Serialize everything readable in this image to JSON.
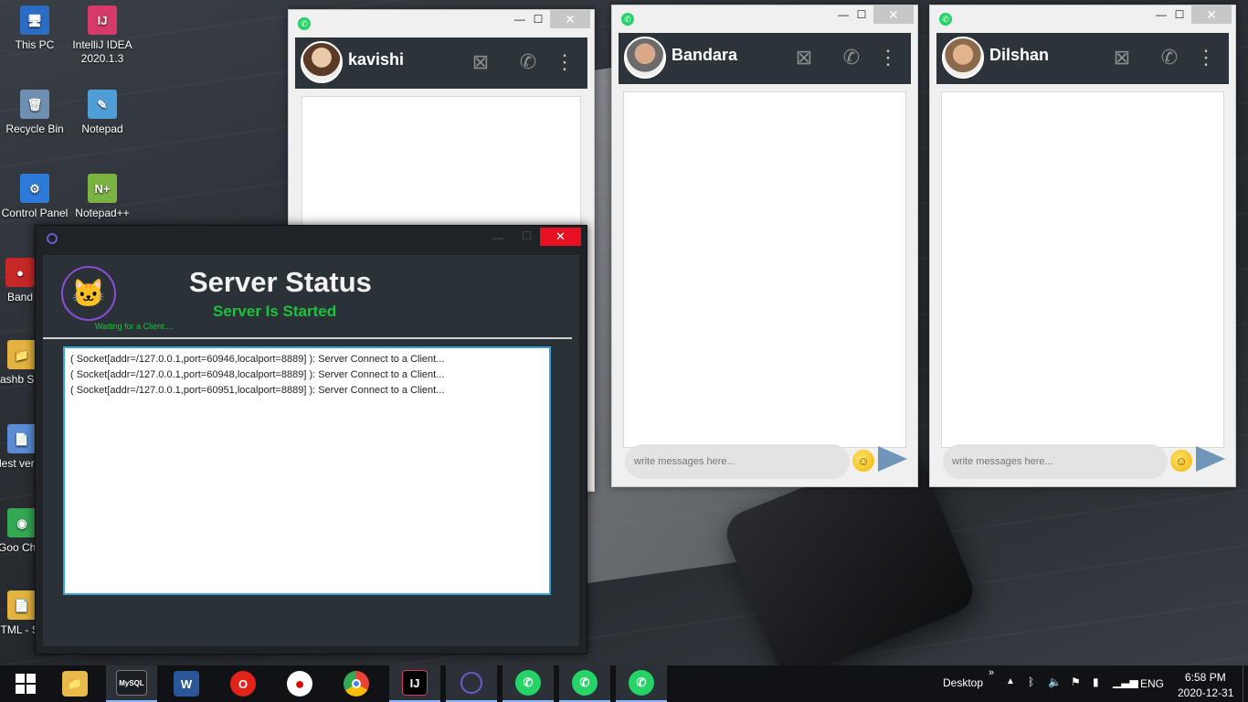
{
  "desktop": {
    "icons": [
      {
        "label": "This PC",
        "glyph": "🖥",
        "color": "#2b6cc4"
      },
      {
        "label": "IntelliJ IDEA 2020.1.3",
        "glyph": "IJ",
        "color": "#d63a6a"
      },
      {
        "label": "Recycle Bin",
        "glyph": "🗑",
        "color": "#6e8fb0"
      },
      {
        "label": "Notepad",
        "glyph": "✎",
        "color": "#4f9fd6"
      },
      {
        "label": "Control Panel",
        "glyph": "⚙",
        "color": "#2d7ad8"
      },
      {
        "label": "Notepad++",
        "glyph": "N+",
        "color": "#7bb342"
      },
      {
        "label": "Band",
        "glyph": "●",
        "color": "#c62828"
      },
      {
        "label": "dashb Shor",
        "glyph": "📁",
        "color": "#e3b341"
      },
      {
        "label": "dest versio",
        "glyph": "📄",
        "color": "#5b8dd6"
      },
      {
        "label": "Goo Chro",
        "glyph": "◉",
        "color": "#34a853"
      },
      {
        "label": "HTML - Sho",
        "glyph": "📄",
        "color": "#e3b341"
      }
    ]
  },
  "chats": [
    {
      "name": "kavishi"
    },
    {
      "name": "Bandara",
      "input_placeholder": "write messages here..."
    },
    {
      "name": "Dilshan",
      "input_placeholder": "write messages here..."
    }
  ],
  "server": {
    "title": "Server Status",
    "status": "Server Is Started",
    "waiting": "Waiting for a Client....",
    "logs": [
      "( Socket[addr=/127.0.0.1,port=60946,localport=8889] ): Server Connect to a Client...",
      "( Socket[addr=/127.0.0.1,port=60948,localport=8889] ): Server Connect to a Client...",
      "( Socket[addr=/127.0.0.1,port=60951,localport=8889] ): Server Connect to a Client..."
    ]
  },
  "taskbar": {
    "apps": [
      {
        "name": "File Explorer",
        "glyph": "📁",
        "color": "#e9b949"
      },
      {
        "name": "MySQL",
        "glyph": "MySQL",
        "color": "#1b1f24"
      },
      {
        "name": "Word",
        "glyph": "W",
        "color": "#2b579a"
      },
      {
        "name": "Opera",
        "glyph": "O",
        "color": "#e2231a"
      },
      {
        "name": "Recorder",
        "glyph": "●",
        "color": "#222"
      },
      {
        "name": "Chrome",
        "glyph": "◉",
        "color": "#34a853"
      },
      {
        "name": "IntelliJ IDEA",
        "glyph": "IJ",
        "color": "#000"
      },
      {
        "name": "Java App",
        "glyph": "○",
        "color": "#6a5acd"
      },
      {
        "name": "WhatsApp 1",
        "glyph": "✆",
        "color": "#25d366"
      },
      {
        "name": "WhatsApp 2",
        "glyph": "✆",
        "color": "#25d366"
      },
      {
        "name": "WhatsApp 3",
        "glyph": "✆",
        "color": "#25d366"
      }
    ],
    "desktop_label": "Desktop",
    "overflow": "»",
    "language": "ENG",
    "time": "6:58 PM",
    "date": "2020-12-31"
  }
}
